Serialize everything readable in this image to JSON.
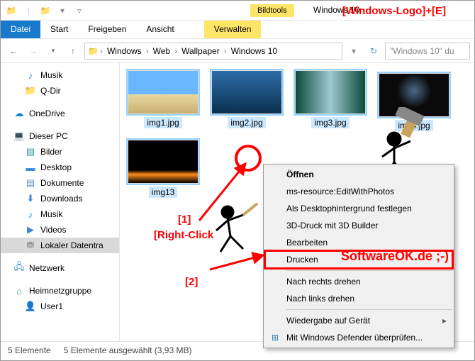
{
  "titlebar": {
    "tools_tab": "Bildtools",
    "title": "Windows 10"
  },
  "shortcut_anno": "[Windows-Logo]+[E]",
  "ribbon": {
    "file": "Datei",
    "start": "Start",
    "share": "Freigeben",
    "view": "Ansicht",
    "manage": "Verwalten"
  },
  "breadcrumb": {
    "c0": "Windows",
    "c1": "Web",
    "c2": "Wallpaper",
    "c3": "Windows 10"
  },
  "search": {
    "placeholder": "\"Windows 10\" du"
  },
  "tree": {
    "music": "Musik",
    "qdir": "Q-Dir",
    "onedrive": "OneDrive",
    "thispc": "Dieser PC",
    "pictures": "Bilder",
    "desktop": "Desktop",
    "documents": "Dokumente",
    "downloads": "Downloads",
    "music2": "Musik",
    "videos": "Videos",
    "localdisk": "Lokaler Datentra",
    "network": "Netzwerk",
    "homegroup": "Heimnetzgruppe",
    "user": "User1"
  },
  "thumbs": {
    "i1": "img1.jpg",
    "i2": "img2.jpg",
    "i3": "img3.jpg",
    "i4": "img4.jpg",
    "i5": "img13"
  },
  "context": {
    "open": "Öffnen",
    "editphotos": "ms-resource:EditWithPhotos",
    "setbg": "Als Desktophintergrund festlegen",
    "print3d": "3D-Druck mit 3D Builder",
    "edit": "Bearbeiten",
    "print": "Drucken",
    "rotr": "Nach rechts drehen",
    "rotl": "Nach links drehen",
    "cast": "Wiedergabe auf Gerät",
    "defender": "Mit Windows Defender überprüfen..."
  },
  "status": {
    "count": "5 Elemente",
    "sel": "5 Elemente ausgewählt (3,93 MB)"
  },
  "anno": {
    "one": "[1]",
    "two": "[2]",
    "rc": "[Right-Click"
  },
  "brand": "SoftwareOK.de ;-)"
}
